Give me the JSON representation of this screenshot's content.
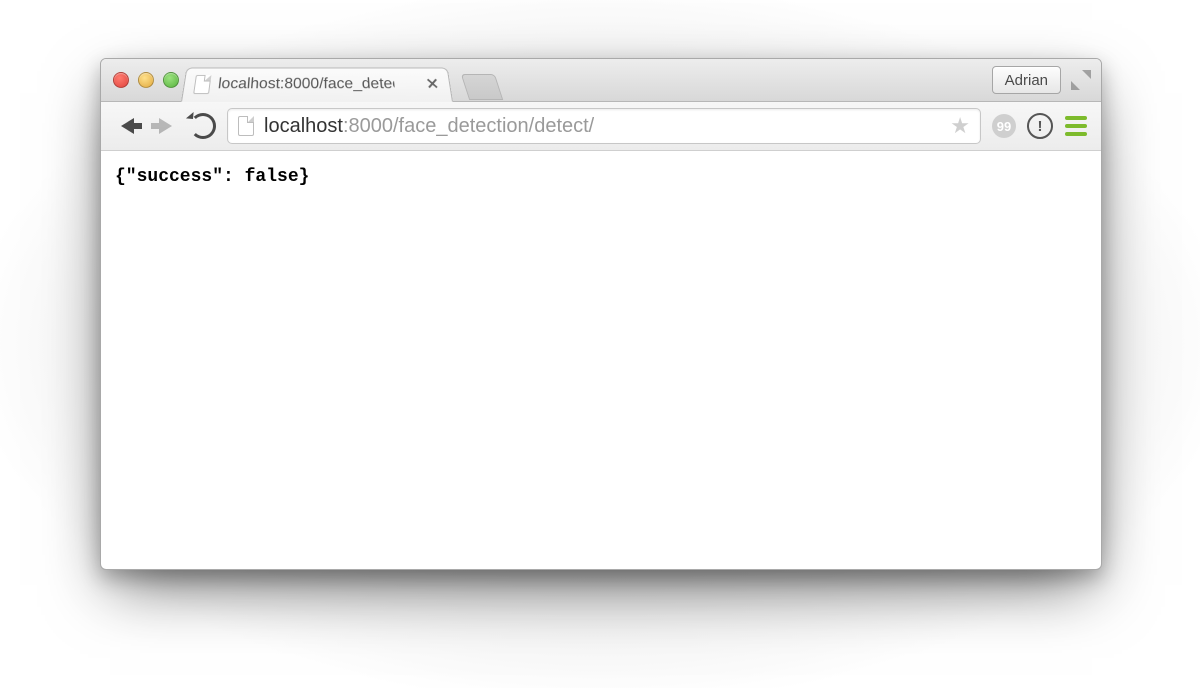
{
  "tab": {
    "title": "localhost:8000/face_detec"
  },
  "profile": {
    "name": "Adrian"
  },
  "url": {
    "host": "localhost",
    "port_path": ":8000/face_detection/detect/"
  },
  "page": {
    "body_text": "{\"success\": false}"
  }
}
